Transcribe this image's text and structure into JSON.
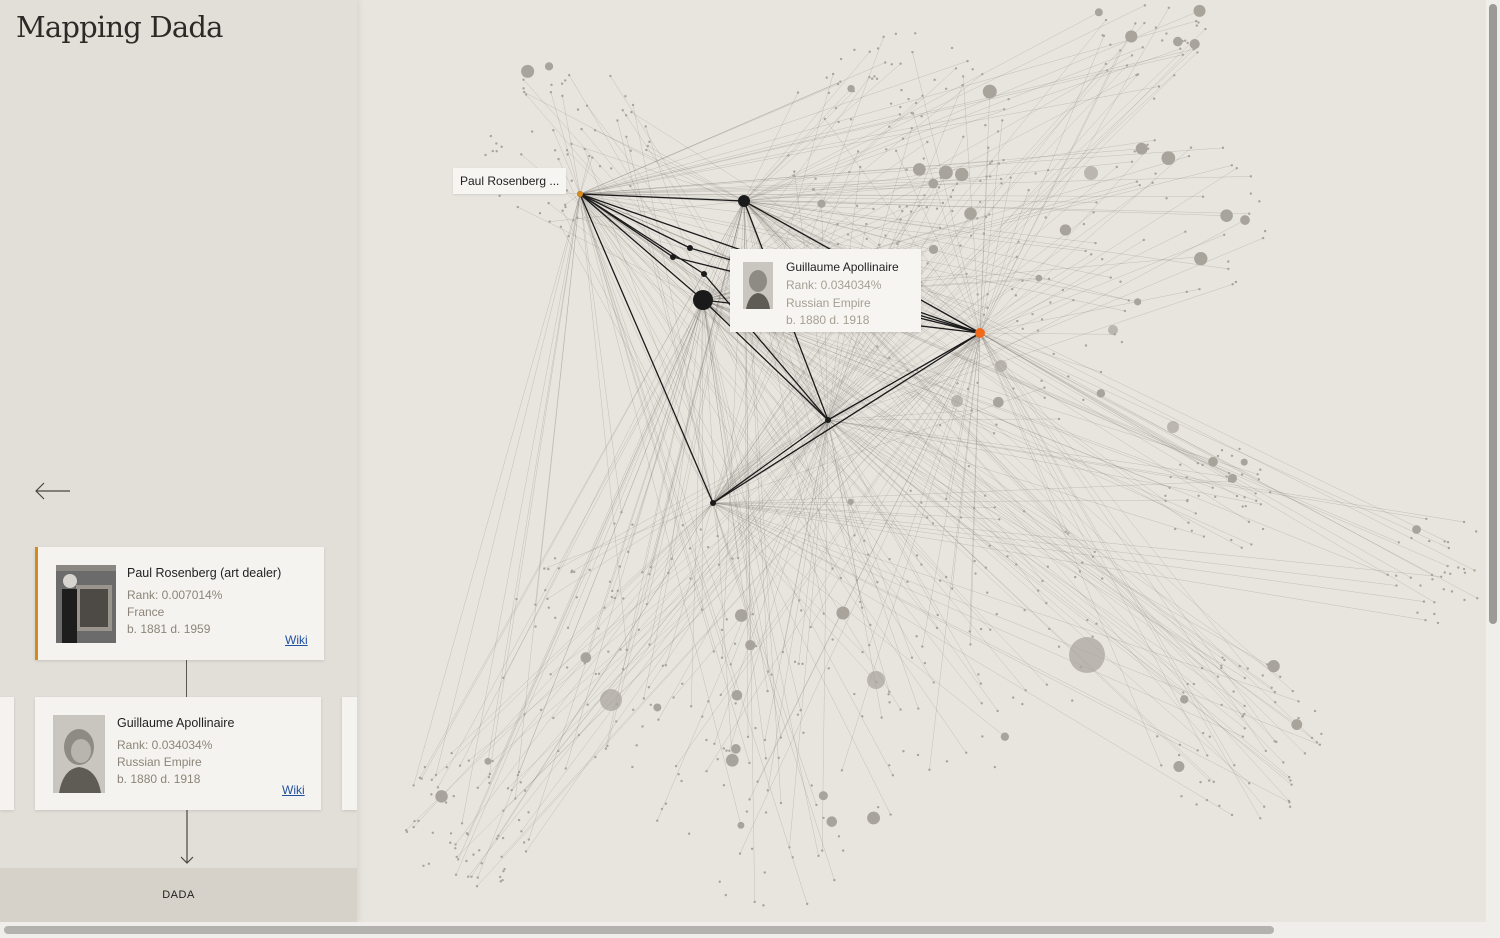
{
  "app": {
    "title": "Mapping Dada"
  },
  "sidebar": {
    "back_icon": "arrow-left-icon",
    "cards": [
      {
        "name": "Paul Rosenberg (art dealer)",
        "rank": "Rank: 0.007014%",
        "country": "France",
        "dates": "b. 1881 d. 1959",
        "wiki": "Wiki",
        "accent": "#d68a1c"
      },
      {
        "name": "Guillaume Apollinaire",
        "rank": "Rank: 0.034034%",
        "country": "Russian Empire",
        "dates": "b. 1880 d. 1918",
        "wiki": "Wiki"
      }
    ],
    "footer": "DADA"
  },
  "graph": {
    "hover_label": "Paul Rosenberg ...",
    "tooltip": {
      "name": "Guillaume Apollinaire",
      "rank": "Rank: 0.034034%",
      "country": "Russian Empire",
      "dates": "b. 1880 d. 1918"
    },
    "colors": {
      "background": "#e8e5df",
      "node": "#a8a39b",
      "highlight_node": "#1a1a1a",
      "selected_node": "#f06a1c"
    }
  }
}
